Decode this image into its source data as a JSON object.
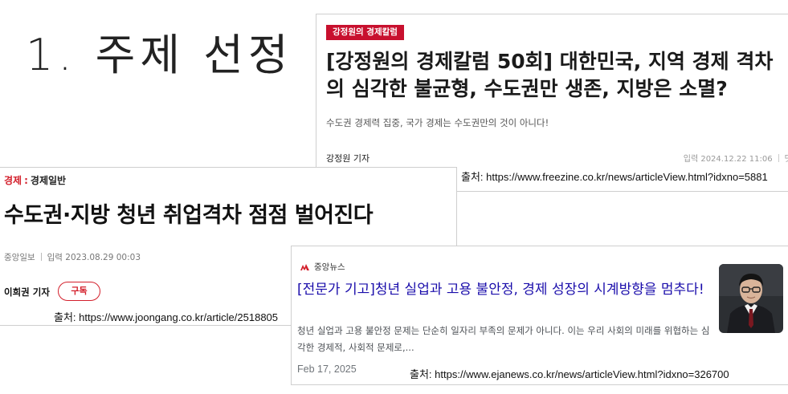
{
  "slide": {
    "title": "1. 주제 선정"
  },
  "card_freezine": {
    "badge": "강정원의 경제칼럼",
    "headline_line1": "[강정원의 경제칼럼 50회] 대한민국, 지역 경제 격차",
    "headline_line2": "의 심각한 불균형, 수도권만 생존, 지방은 소멸?",
    "subtitle": "수도권 경제력 집중, 국가 경제는 수도권만의 것이 아니다!",
    "byline": "강정원 기자",
    "timestamp": "입력 2024.12.22 11:06",
    "comments_label": "댓글",
    "source": "출처: https://www.freezine.co.kr/news/articleView.html?idxno=5881"
  },
  "card_joongang": {
    "section": "경제",
    "section_colon": ":",
    "subsection": "경제일반",
    "headline": "수도권·지방 청년 취업격차 점점 벌어진다",
    "outlet": "중앙일보",
    "timestamp": "입력 2023.08.29 00:03",
    "reporter": "이희권 기자",
    "subscribe_label": "구독",
    "source": "출처: https://www.joongang.co.kr/article/2518805"
  },
  "card_ejanews": {
    "publisher": "중앙뉴스",
    "headline": "[전문가 기고]청년 실업과 고용 불안정, 경제 성장의 시계방향을 멈추다!",
    "snippet": "청년 실업과 고용 불안정 문제는 단순히 일자리 부족의 문제가 아니다. 이는 우리 사회의 미래를 위협하는 심각한 경제적, 사회적 문제로,...",
    "date": "Feb 17, 2025",
    "source": "출처: https://www.ejanews.co.kr/news/articleView.html?idxno=326700",
    "thumbnail_icon": "person-portrait"
  },
  "colors": {
    "freezine_badge": "#c8102e",
    "joongang_accent": "#d31f2b",
    "google_link": "#1a0dab",
    "snippet_text": "#4d5156"
  }
}
